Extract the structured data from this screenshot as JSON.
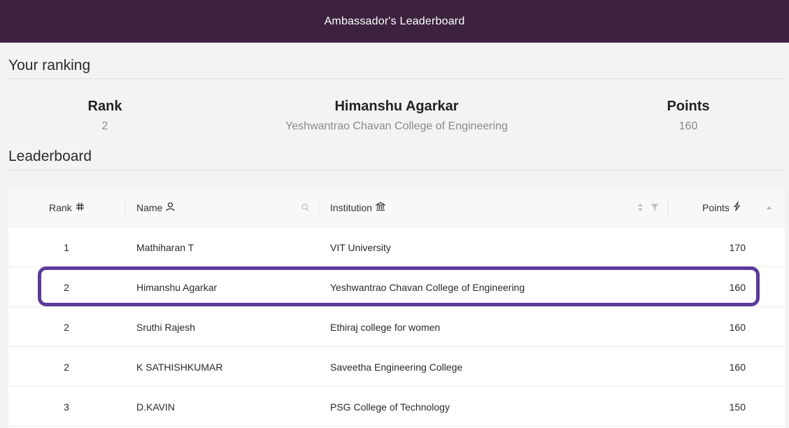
{
  "header": {
    "title": "Ambassador's Leaderboard"
  },
  "your_ranking": {
    "heading": "Your ranking",
    "rank_label": "Rank",
    "rank_value": "2",
    "name": "Himanshu Agarkar",
    "institution": "Yeshwantrao Chavan College of Engineering",
    "points_label": "Points",
    "points_value": "160"
  },
  "leaderboard": {
    "heading": "Leaderboard",
    "columns": {
      "rank": "Rank",
      "name": "Name",
      "institution": "Institution",
      "points": "Points"
    },
    "icons": {
      "rank": "hash-icon",
      "name": "user-icon",
      "search": "search-icon",
      "institution": "bank-icon",
      "sort": "sort-icon",
      "filter": "filter-icon",
      "points": "lightning-icon",
      "sort_asc": "caret-up-icon"
    },
    "rows": [
      {
        "rank": "1",
        "name": "Mathiharan T",
        "institution": "VIT University",
        "points": "170"
      },
      {
        "rank": "2",
        "name": "Himanshu Agarkar",
        "institution": "Yeshwantrao Chavan College of Engineering",
        "points": "160"
      },
      {
        "rank": "2",
        "name": "Sruthi Rajesh",
        "institution": "Ethiraj college for women",
        "points": "160"
      },
      {
        "rank": "2",
        "name": "K SATHISHKUMAR",
        "institution": "Saveetha Engineering College",
        "points": "160"
      },
      {
        "rank": "3",
        "name": "D.KAVIN",
        "institution": "PSG College of Technology",
        "points": "150"
      }
    ],
    "highlighted_row": 1
  },
  "colors": {
    "header_bg": "#3d2240",
    "highlight_border": "#5b3a99",
    "page_bg": "#f3f3f3"
  }
}
